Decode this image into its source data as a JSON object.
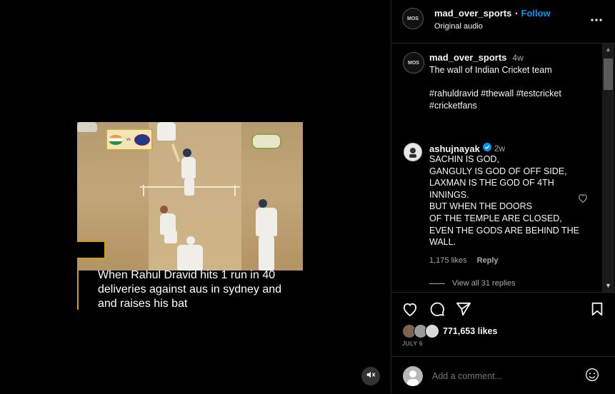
{
  "post": {
    "author": "mad_over_sports",
    "avatar_text": "MOS",
    "follow_label": "Follow",
    "separator": "•",
    "audio": "Original audio"
  },
  "video": {
    "caption": "When Rahul Dravid hits 1 run in 40 deliveries against aus in sydney and and raises his bat",
    "muted": true
  },
  "caption_comment": {
    "author": "mad_over_sports",
    "time": "4w",
    "text": "The wall of Indian Cricket team",
    "hashtags": "#rahuldravid #thewall #testcricket #cricketfans"
  },
  "comment": {
    "author": "ashujnayak",
    "verified": true,
    "time": "2w",
    "lines": [
      "SACHIN IS GOD,",
      "GANGULY IS GOD OF OFF SIDE,",
      "LAXMAN IS THE GOD OF 4TH",
      "INNINGS.",
      "BUT WHEN THE DOORS",
      "OF THE TEMPLE ARE CLOSED,",
      "EVEN THE GODS ARE BEHIND THE",
      "WALL."
    ],
    "likes": "1,175 likes",
    "reply_label": "Reply",
    "view_replies": "View all 31 replies"
  },
  "engagement": {
    "likes": "771,653 likes",
    "date": "JULY 6"
  },
  "add_comment": {
    "placeholder": "Add a comment..."
  },
  "colors": {
    "accent": "#0095f6",
    "caption_border": "#d0a300"
  }
}
